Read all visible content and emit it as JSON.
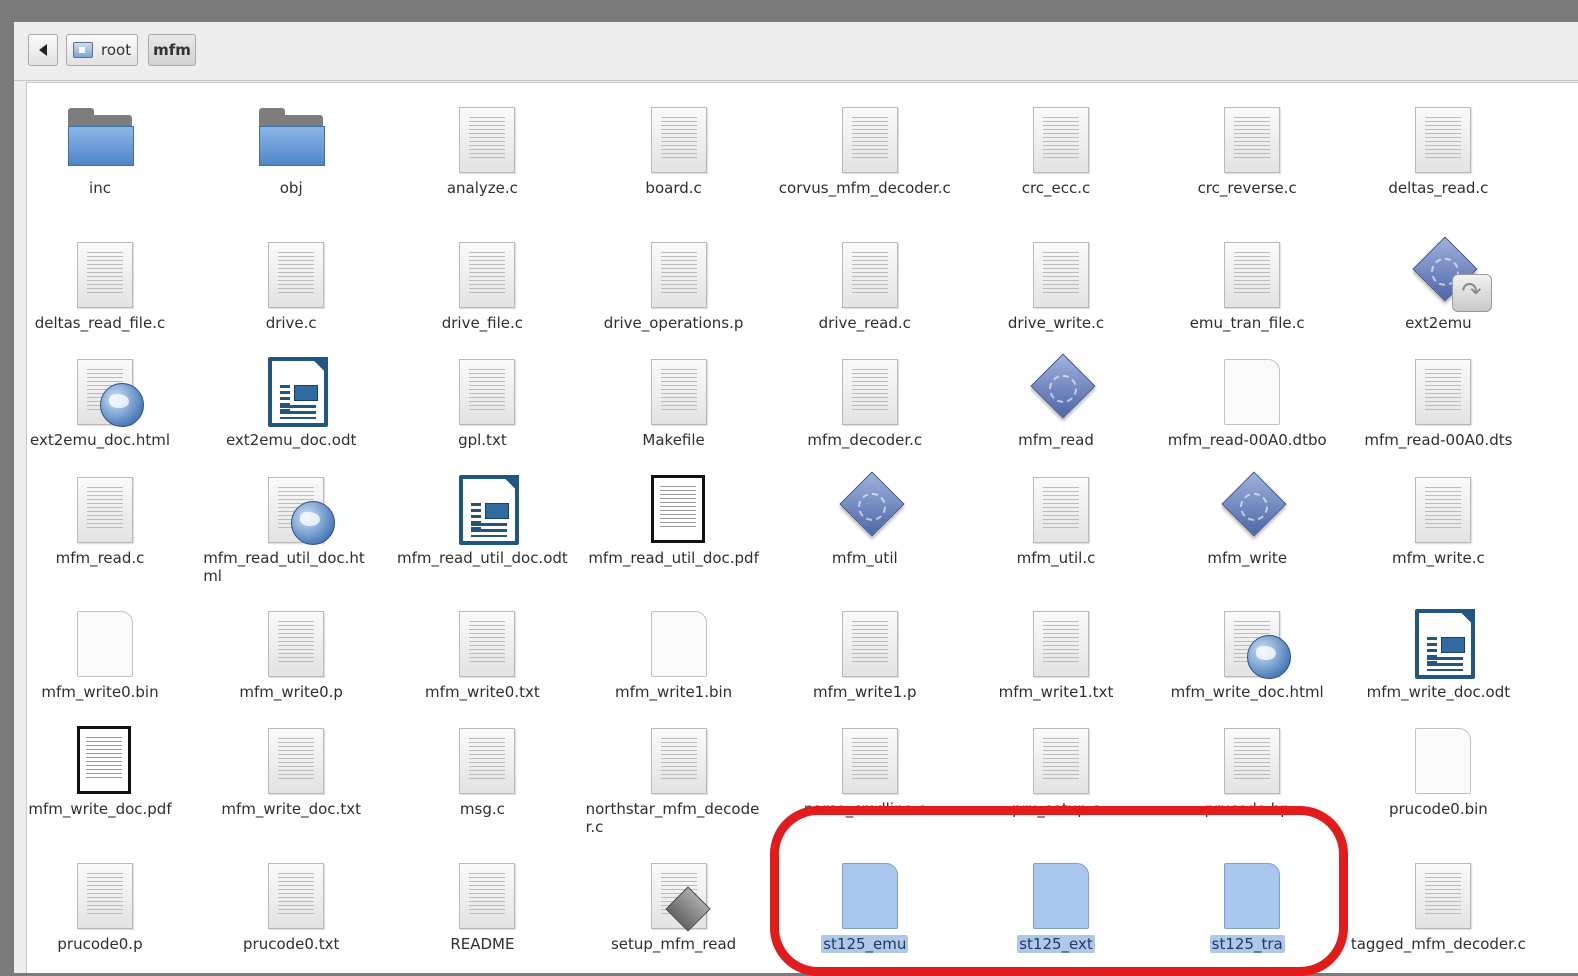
{
  "breadcrumb": {
    "root": "root",
    "current": "mfm"
  },
  "selection_highlight_color": "#b0c8e8",
  "annotation_color": "#e21c1c",
  "files": [
    {
      "name": "inc",
      "icon": "folder-icon"
    },
    {
      "name": "obj",
      "icon": "folder-icon"
    },
    {
      "name": "analyze.c",
      "icon": "text-file-icon"
    },
    {
      "name": "board.c",
      "icon": "text-file-icon"
    },
    {
      "name": "corvus_mfm_decoder.c",
      "icon": "text-file-icon"
    },
    {
      "name": "crc_ecc.c",
      "icon": "text-file-icon"
    },
    {
      "name": "crc_reverse.c",
      "icon": "text-file-icon"
    },
    {
      "name": "deltas_read.c",
      "icon": "text-file-icon"
    },
    {
      "name": "deltas_read_file.c",
      "icon": "text-file-icon"
    },
    {
      "name": "drive.c",
      "icon": "text-file-icon"
    },
    {
      "name": "drive_file.c",
      "icon": "text-file-icon"
    },
    {
      "name": "drive_operations.p",
      "icon": "text-file-icon"
    },
    {
      "name": "drive_read.c",
      "icon": "text-file-icon"
    },
    {
      "name": "drive_write.c",
      "icon": "text-file-icon"
    },
    {
      "name": "emu_tran_file.c",
      "icon": "text-file-icon"
    },
    {
      "name": "ext2emu",
      "icon": "executable-link-icon"
    },
    {
      "name": "ext2emu_doc.html",
      "icon": "html-file-icon"
    },
    {
      "name": "ext2emu_doc.odt",
      "icon": "odt-document-icon"
    },
    {
      "name": "gpl.txt",
      "icon": "text-file-icon"
    },
    {
      "name": "Makefile",
      "icon": "text-file-icon"
    },
    {
      "name": "mfm_decoder.c",
      "icon": "text-file-icon"
    },
    {
      "name": "mfm_read",
      "icon": "executable-icon"
    },
    {
      "name": "mfm_read-00A0.dtbo",
      "icon": "blank-file-icon"
    },
    {
      "name": "mfm_read-00A0.dts",
      "icon": "text-file-icon"
    },
    {
      "name": "mfm_read.c",
      "icon": "text-file-icon"
    },
    {
      "name": "mfm_read_util_doc.html",
      "icon": "html-file-icon"
    },
    {
      "name": "mfm_read_util_doc.odt",
      "icon": "odt-document-icon"
    },
    {
      "name": "mfm_read_util_doc.pdf",
      "icon": "pdf-file-icon"
    },
    {
      "name": "mfm_util",
      "icon": "executable-icon"
    },
    {
      "name": "mfm_util.c",
      "icon": "text-file-icon"
    },
    {
      "name": "mfm_write",
      "icon": "executable-icon"
    },
    {
      "name": "mfm_write.c",
      "icon": "text-file-icon"
    },
    {
      "name": "mfm_write0.bin",
      "icon": "blank-file-icon"
    },
    {
      "name": "mfm_write0.p",
      "icon": "text-file-icon"
    },
    {
      "name": "mfm_write0.txt",
      "icon": "text-file-icon"
    },
    {
      "name": "mfm_write1.bin",
      "icon": "blank-file-icon"
    },
    {
      "name": "mfm_write1.p",
      "icon": "text-file-icon"
    },
    {
      "name": "mfm_write1.txt",
      "icon": "text-file-icon"
    },
    {
      "name": "mfm_write_doc.html",
      "icon": "html-file-icon"
    },
    {
      "name": "mfm_write_doc.odt",
      "icon": "odt-document-icon"
    },
    {
      "name": "mfm_write_doc.pdf",
      "icon": "pdf-file-icon"
    },
    {
      "name": "mfm_write_doc.txt",
      "icon": "text-file-icon"
    },
    {
      "name": "msg.c",
      "icon": "text-file-icon"
    },
    {
      "name": "northstar_mfm_decoder.c",
      "icon": "text-file-icon"
    },
    {
      "name": "parse_cmdline.c",
      "icon": "text-file-icon"
    },
    {
      "name": "pru_setup.c",
      "icon": "text-file-icon"
    },
    {
      "name": "prucode.hp",
      "icon": "text-file-icon"
    },
    {
      "name": "prucode0.bin",
      "icon": "blank-file-icon"
    },
    {
      "name": "prucode0.p",
      "icon": "text-file-icon"
    },
    {
      "name": "prucode0.txt",
      "icon": "text-file-icon"
    },
    {
      "name": "README",
      "icon": "text-file-icon"
    },
    {
      "name": "setup_mfm_read",
      "icon": "script-file-icon"
    },
    {
      "name": "st125_emu",
      "icon": "selected-file-icon",
      "selected": true
    },
    {
      "name": "st125_ext",
      "icon": "selected-file-icon",
      "selected": true
    },
    {
      "name": "st125_tra",
      "icon": "selected-file-icon",
      "selected": true
    },
    {
      "name": "tagged_mfm_decoder.c",
      "icon": "text-file-icon"
    }
  ]
}
